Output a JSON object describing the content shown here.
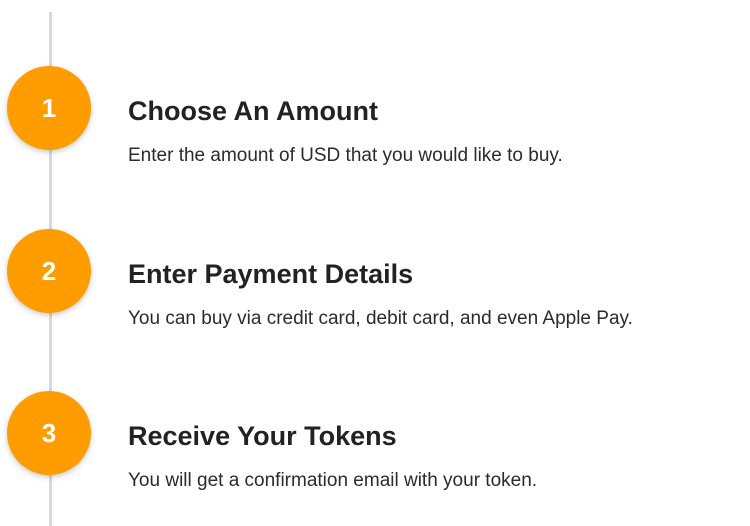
{
  "colors": {
    "accent": "#ff9d00",
    "timeline": "#d9d9d9",
    "title_text": "#222222",
    "body_text": "#2b2b2b"
  },
  "steps": [
    {
      "number": "1",
      "title": "Choose An Amount",
      "description": "Enter the amount of USD that you would like to buy."
    },
    {
      "number": "2",
      "title": "Enter Payment Details",
      "description": "You can buy via credit card, debit card, and even Apple Pay."
    },
    {
      "number": "3",
      "title": "Receive Your Tokens",
      "description": "You will get a confirmation email with your token."
    }
  ]
}
